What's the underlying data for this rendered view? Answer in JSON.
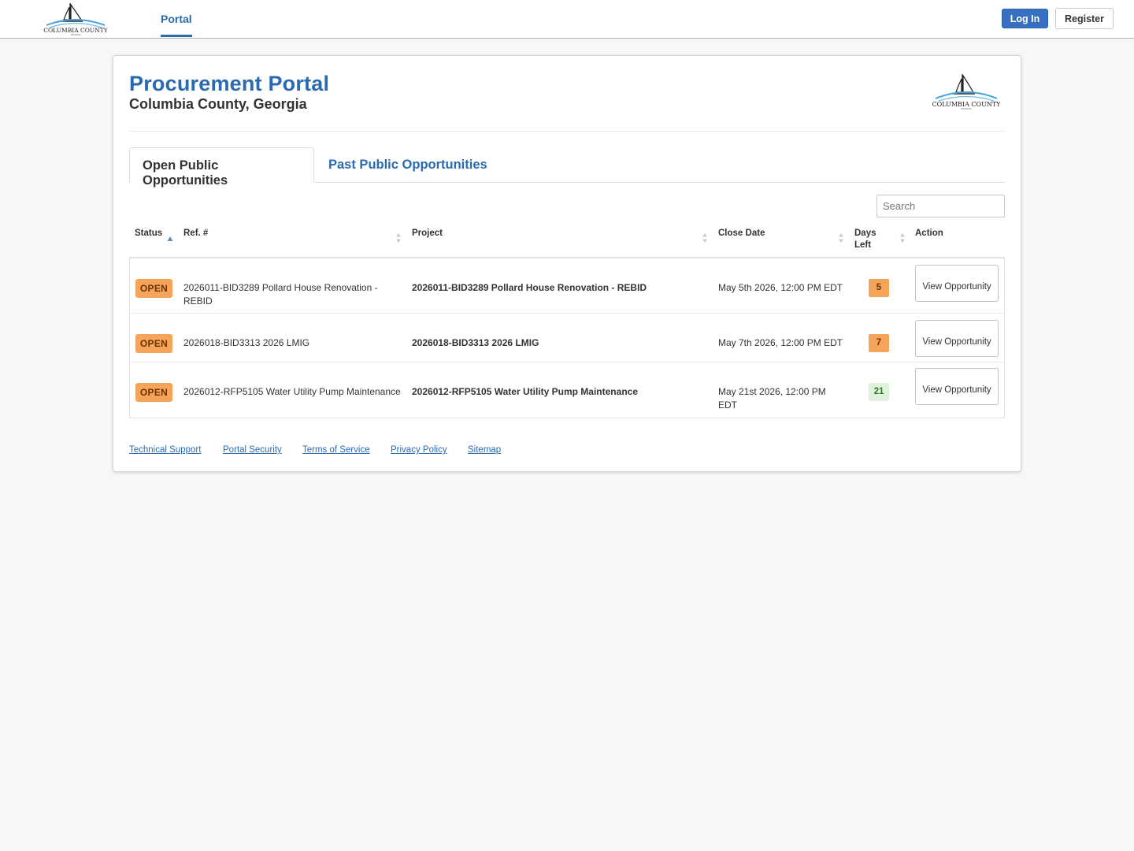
{
  "nav": {
    "logo_alt": "Columbia County",
    "tab_label": "Portal",
    "login_label": "Log In",
    "register_label": "Register"
  },
  "header": {
    "title": "Procurement Portal",
    "subtitle": "Columbia County, Georgia"
  },
  "tabs": [
    {
      "label": "Open Public Opportunities",
      "active": true
    },
    {
      "label": "Past Public Opportunities",
      "active": false
    }
  ],
  "search": {
    "placeholder": "Search"
  },
  "table": {
    "columns": [
      {
        "label": "Status",
        "sort": "asc"
      },
      {
        "label": "Ref. #",
        "sort": "none"
      },
      {
        "label": "Project",
        "sort": "none"
      },
      {
        "label": "Close Date",
        "sort": "none"
      },
      {
        "label": "Days Left",
        "sort": "none"
      },
      {
        "label": "Action",
        "sort": "none"
      }
    ],
    "rows": [
      {
        "status": "OPEN",
        "ref": "2026011-BID3289 Pollard House Renovation - REBID",
        "project": "2026011-BID3289 Pollard House Renovation - REBID",
        "close_date": "May 5th 2026, 12:00 PM EDT",
        "days_left": "5",
        "action": "View Opportunity"
      },
      {
        "status": "OPEN",
        "ref": "2026018-BID3313 2026 LMIG",
        "project": "2026018-BID3313 2026 LMIG",
        "close_date": "May 7th 2026, 12:00 PM EDT",
        "days_left": "7",
        "action": "View Opportunity"
      },
      {
        "status": "OPEN",
        "ref": "2026012-RFP5105 Water Utility Pump Maintenance",
        "project": "2026012-RFP5105 Water Utility Pump Maintenance",
        "close_date": "May 21st 2026, 12:00 PM EDT",
        "days_left": "21",
        "action": "View Opportunity"
      }
    ]
  },
  "footer": {
    "links": [
      "Technical Support",
      "Portal Security",
      "Terms of Service",
      "Privacy Policy",
      "Sitemap"
    ]
  },
  "colors": {
    "brand_blue": "#2a6ab0",
    "login_bg": "#3770c1",
    "status_open": "#f5a45b",
    "days_ok_bg": "#def2dc"
  }
}
